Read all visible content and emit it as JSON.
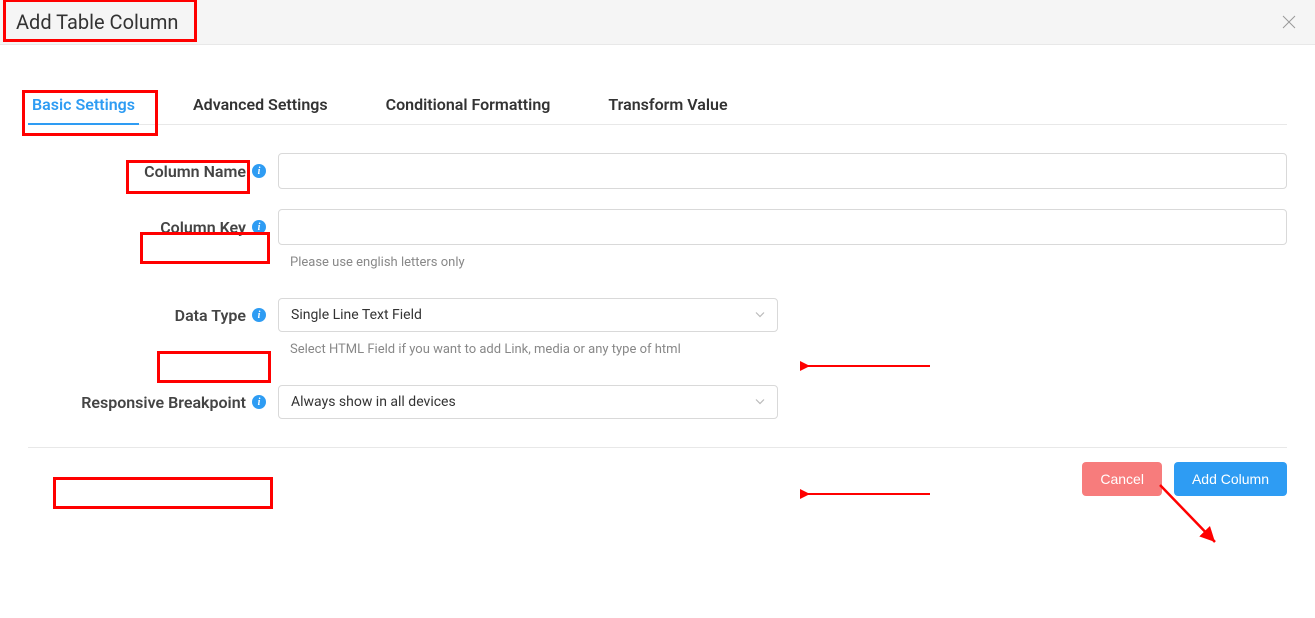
{
  "dialog": {
    "title": "Add Table Column"
  },
  "tabs": {
    "items": [
      {
        "label": "Basic Settings",
        "active": true
      },
      {
        "label": "Advanced Settings",
        "active": false
      },
      {
        "label": "Conditional Formatting",
        "active": false
      },
      {
        "label": "Transform Value",
        "active": false
      }
    ]
  },
  "form": {
    "column_name": {
      "label": "Column Name",
      "value": ""
    },
    "column_key": {
      "label": "Column Key",
      "value": "",
      "help": "Please use english letters only"
    },
    "data_type": {
      "label": "Data Type",
      "selected": "Single Line Text Field",
      "help": "Select HTML Field if you want to add Link, media or any type of html"
    },
    "responsive_breakpoint": {
      "label": "Responsive Breakpoint",
      "selected": "Always show in all devices"
    }
  },
  "footer": {
    "cancel": "Cancel",
    "submit": "Add Column"
  }
}
